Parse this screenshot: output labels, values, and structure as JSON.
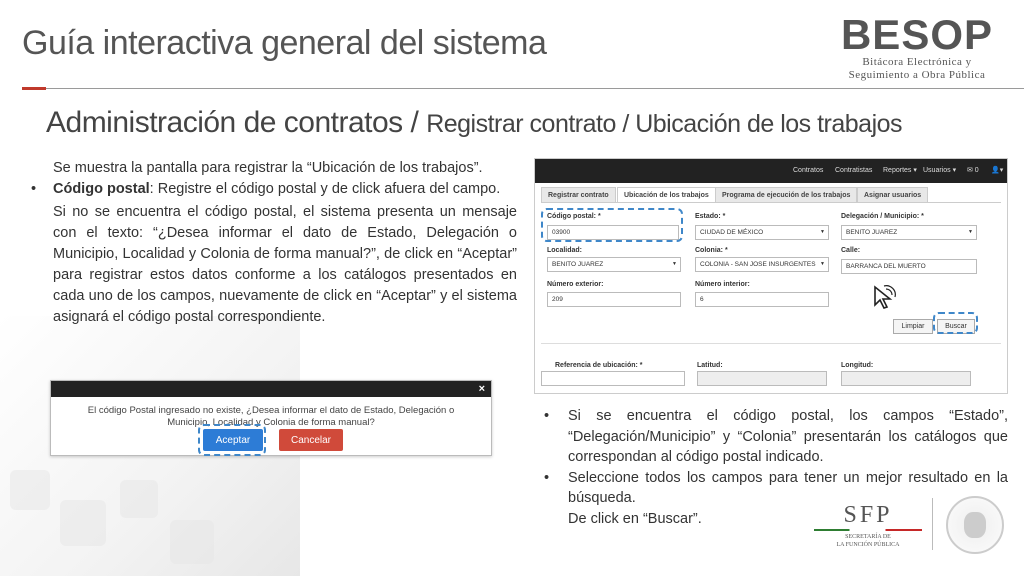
{
  "header": {
    "title": "Guía interactiva general del sistema",
    "logo_main": "BESOP",
    "logo_line1": "Bitácora Electrónica y",
    "logo_line2": "Seguimiento a Obra Pública"
  },
  "subtitle": {
    "main": "Administración de contratos / ",
    "small": "Registrar contrato / Ubicación de los trabajos"
  },
  "left_text": {
    "intro": "Se muestra la pantalla para registrar la “Ubicación de los trabajos”.",
    "bullet_bold": "Código postal",
    "bullet_rest": ": Registre el código postal y de click afuera del campo.",
    "para": "Si no se encuentra el código postal, el sistema presenta un mensaje con el texto: “¿Desea informar el dato de Estado, Delegación o Municipio, Localidad y Colonia de forma manual?”, de click en “Aceptar” para registrar estos datos conforme a los catálogos presentados en cada uno de los campos, nuevamente de click en “Aceptar” y el sistema asignará el código postal correspondiente."
  },
  "dialog": {
    "close": "×",
    "message": "El código Postal ingresado no existe, ¿Desea informar el dato de Estado, Delegación o Municipio, Localidad y Colonia de forma manual?",
    "accept": "Aceptar",
    "cancel": "Cancelar"
  },
  "screenshot": {
    "nav": {
      "contratos": "Contratos",
      "contratistas": "Contratistas",
      "reportes": "Reportes ▾",
      "usuarios": "Usuarios ▾",
      "mail": "✉ 0",
      "user": "👤▾"
    },
    "tabs": [
      "Registrar contrato",
      "Ubicación de los trabajos",
      "Programa de ejecución de los trabajos",
      "Asignar usuarios"
    ],
    "fields": {
      "cp_label": "Código postal: *",
      "cp_value": "03900",
      "estado_label": "Estado: *",
      "estado_value": "CIUDAD DE MÉXICO",
      "delegacion_label": "Delegación / Municipio: *",
      "delegacion_value": "BENITO JUAREZ",
      "localidad_label": "Localidad:",
      "localidad_value": "BENITO JUAREZ",
      "colonia_label": "Colonia: *",
      "colonia_value": "COLONIA - SAN JOSE INSURGENTES",
      "calle_label": "Calle:",
      "calle_value": "BARRANCA DEL MUERTO",
      "ext_label": "Número exterior:",
      "ext_value": "209",
      "int_label": "Número interior:",
      "int_value": "6",
      "ref_label": "Referencia de ubicación: *",
      "lat_label": "Latitud:",
      "lon_label": "Longitud:"
    },
    "buttons": {
      "limpiar": "Limpiar",
      "buscar": "Buscar"
    }
  },
  "right_text": {
    "bullet1": "Si se encuentra el código postal, los campos “Estado”, “Delegación/Municipio” y “Colonia” presentarán los catálogos que correspondan al código postal indicado.",
    "bullet2": "Seleccione todos los campos para tener un mejor resultado en la búsqueda.",
    "line3": "De click en “Buscar”."
  },
  "footer": {
    "sfp": "SFP",
    "sfp_line1": "SECRETARÍA DE",
    "sfp_line2": "LA FUNCIÓN PÚBLICA"
  },
  "colors": {
    "accent_red": "#c0392b",
    "dash_blue": "#3f87c9",
    "accept_blue": "#2d7cd6",
    "cancel_red": "#d04a3a"
  }
}
